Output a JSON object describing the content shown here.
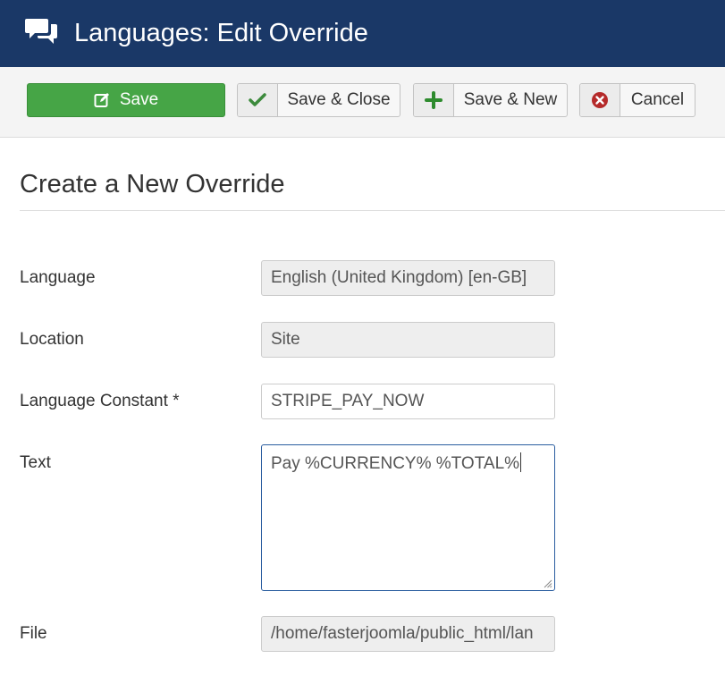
{
  "header": {
    "title": "Languages: Edit Override",
    "icon": "chat-bubbles-icon"
  },
  "toolbar": {
    "save_label": "Save",
    "save_close_label": "Save & Close",
    "save_new_label": "Save & New",
    "cancel_label": "Cancel",
    "colors": {
      "save_bg": "#46a546",
      "check": "#3c8a3c",
      "plus": "#2e8b2e",
      "cancel": "#b52a2a"
    }
  },
  "form": {
    "title": "Create a New Override",
    "language": {
      "label": "Language",
      "value": "English (United Kingdom) [en-GB]"
    },
    "location": {
      "label": "Location",
      "value": "Site"
    },
    "constant": {
      "label": "Language Constant *",
      "value": "STRIPE_PAY_NOW"
    },
    "text": {
      "label": "Text",
      "value": "Pay %CURRENCY% %TOTAL%"
    },
    "file": {
      "label": "File",
      "value": "/home/fasterjoomla/public_html/lan"
    }
  },
  "colors": {
    "header_bg": "#1a3867",
    "focus_border": "#2a5d9f"
  }
}
